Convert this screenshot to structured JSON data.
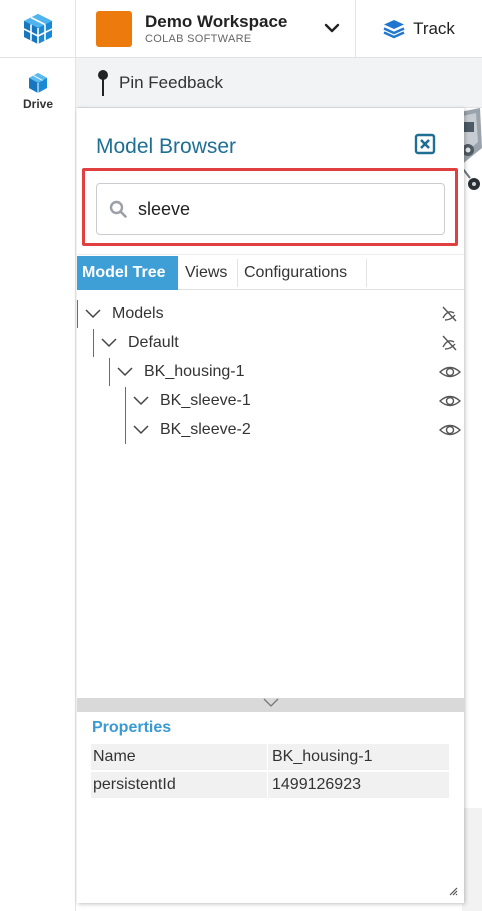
{
  "rail": {
    "drive_label": "Drive"
  },
  "workspace": {
    "name": "Demo Workspace",
    "subtitle": "COLAB SOFTWARE",
    "swatch_color": "#ec7a0d"
  },
  "track": {
    "label": "Track"
  },
  "pinbar": {
    "label": "Pin Feedback"
  },
  "panel": {
    "title": "Model Browser",
    "search": {
      "value": "sleeve",
      "highlight_color": "#e0403f"
    },
    "tabs": [
      {
        "label": "Model Tree",
        "active": true
      },
      {
        "label": "Views",
        "active": false
      },
      {
        "label": "Configurations",
        "active": false
      }
    ],
    "tree": [
      {
        "label": "Models",
        "depth": 0,
        "visibility": "hidden"
      },
      {
        "label": "Default",
        "depth": 1,
        "visibility": "hidden"
      },
      {
        "label": "BK_housing-1",
        "depth": 2,
        "visibility": "visible"
      },
      {
        "label": "BK_sleeve-1",
        "depth": 3,
        "visibility": "visible"
      },
      {
        "label": "BK_sleeve-2",
        "depth": 3,
        "visibility": "visible"
      }
    ],
    "properties": {
      "title": "Properties",
      "rows": [
        {
          "key": "Name",
          "value": "BK_housing-1"
        },
        {
          "key": "persistentId",
          "value": "1499126923"
        }
      ]
    }
  },
  "colors": {
    "accent": "#3e9fd7",
    "title_blue": "#1f6f95",
    "tree_line": "#2b7fa8"
  }
}
